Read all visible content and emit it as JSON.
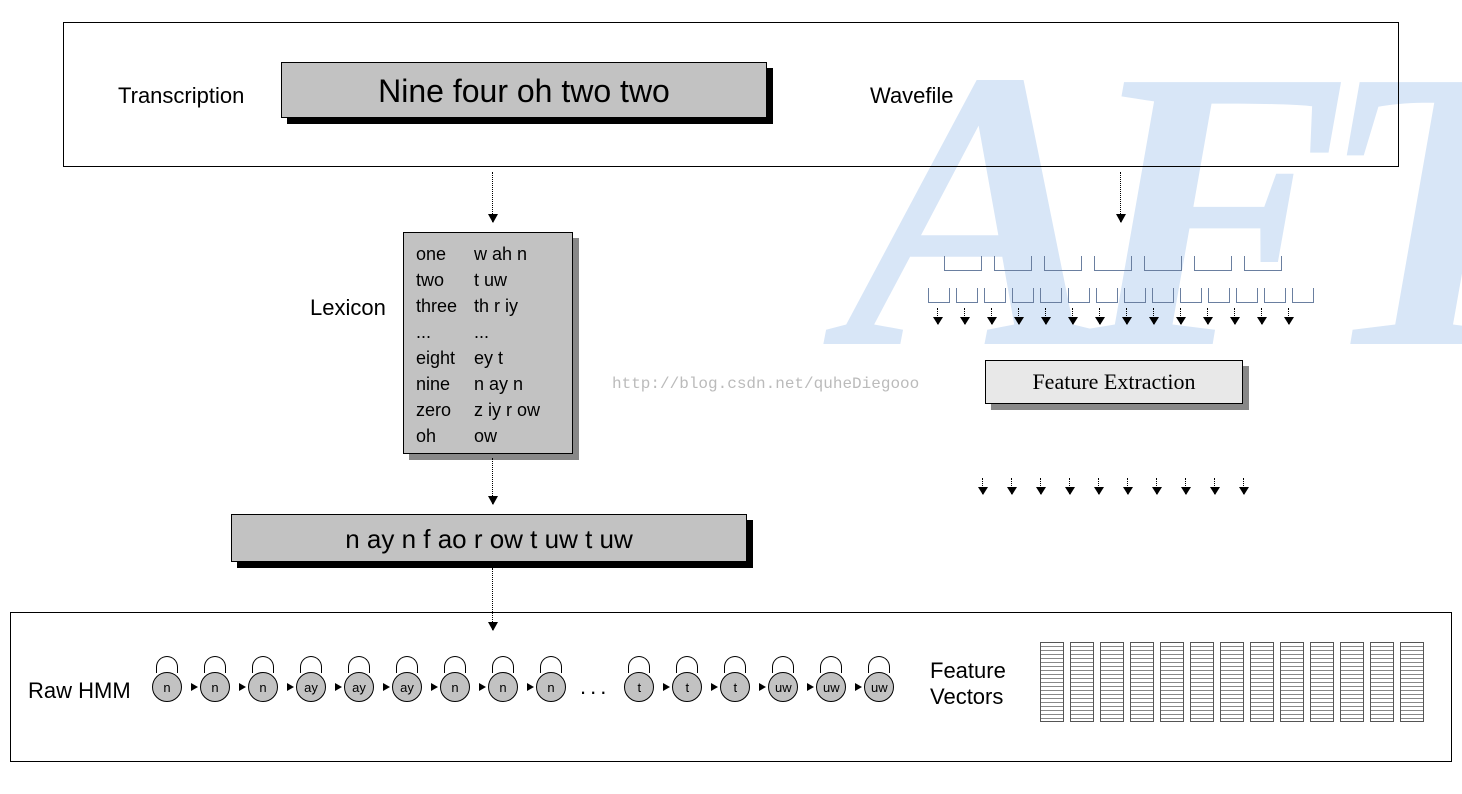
{
  "labels": {
    "transcription": "Transcription",
    "wavefile": "Wavefile",
    "lexicon": "Lexicon",
    "raw_hmm": "Raw HMM",
    "feature_extraction": "Feature Extraction",
    "feature_vectors_l1": "Feature",
    "feature_vectors_l2": "Vectors"
  },
  "transcription_text": "Nine four oh two two",
  "phoneme_string": "n ay n f ao r ow t uw t uw",
  "lexicon": [
    {
      "word": "one",
      "phones": "w ah n"
    },
    {
      "word": "two",
      "phones": "t uw"
    },
    {
      "word": "three",
      "phones": "th r iy"
    },
    {
      "word": "...",
      "phones": "..."
    },
    {
      "word": "eight",
      "phones": "ey t"
    },
    {
      "word": "nine",
      "phones": "n ay n"
    },
    {
      "word": "zero",
      "phones": "z iy r ow"
    },
    {
      "word": "oh",
      "phones": "ow"
    }
  ],
  "hmm_left": [
    "n",
    "n",
    "n",
    "ay",
    "ay",
    "ay",
    "n",
    "n",
    "n"
  ],
  "hmm_right": [
    "t",
    "t",
    "t",
    "uw",
    "uw",
    "uw"
  ],
  "watermark_url": "http://blog.csdn.net/quheDiegooo",
  "watermark_big": "AFT",
  "feature_vector_count": 13,
  "frame_brackets_row1": 7,
  "frame_brackets_row2": 14,
  "multi_arrows_count": 14,
  "bottom_multi_arrows_count": 10
}
